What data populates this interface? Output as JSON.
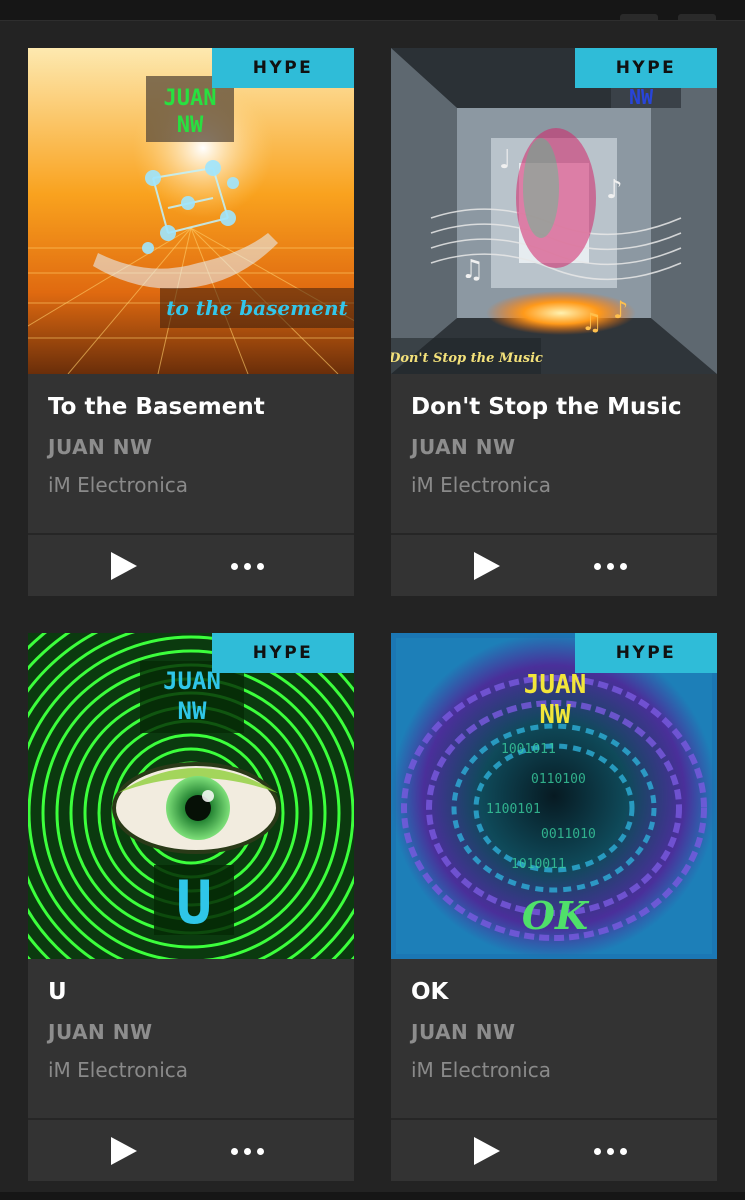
{
  "releases": [
    {
      "title": "To the Basement",
      "artist": "JUAN NW",
      "label": "iM Electronica",
      "badge": "HYPE",
      "art_text": {
        "logo_line1": "JUAN",
        "logo_line2": "NW",
        "caption": "to the basement"
      }
    },
    {
      "title": "Don't Stop the Music",
      "artist": "JUAN NW",
      "label": "iM Electronica",
      "badge": "HYPE",
      "art_text": {
        "logo_line2": "NW",
        "caption": "Don't Stop the Music"
      }
    },
    {
      "title": "U",
      "artist": "JUAN NW",
      "label": "iM Electronica",
      "badge": "HYPE",
      "art_text": {
        "logo_line1": "JUAN",
        "logo_line2": "NW",
        "caption": "U"
      }
    },
    {
      "title": "OK",
      "artist": "JUAN NW",
      "label": "iM Electronica",
      "badge": "HYPE",
      "art_text": {
        "logo_line1": "JUAN",
        "logo_line2": "NW",
        "caption": "OK"
      }
    }
  ],
  "icons": {
    "play": "play-icon",
    "more": "more-icon"
  },
  "colors": {
    "badge": "#2fbcd8",
    "card": "#333333",
    "background": "#232323"
  }
}
